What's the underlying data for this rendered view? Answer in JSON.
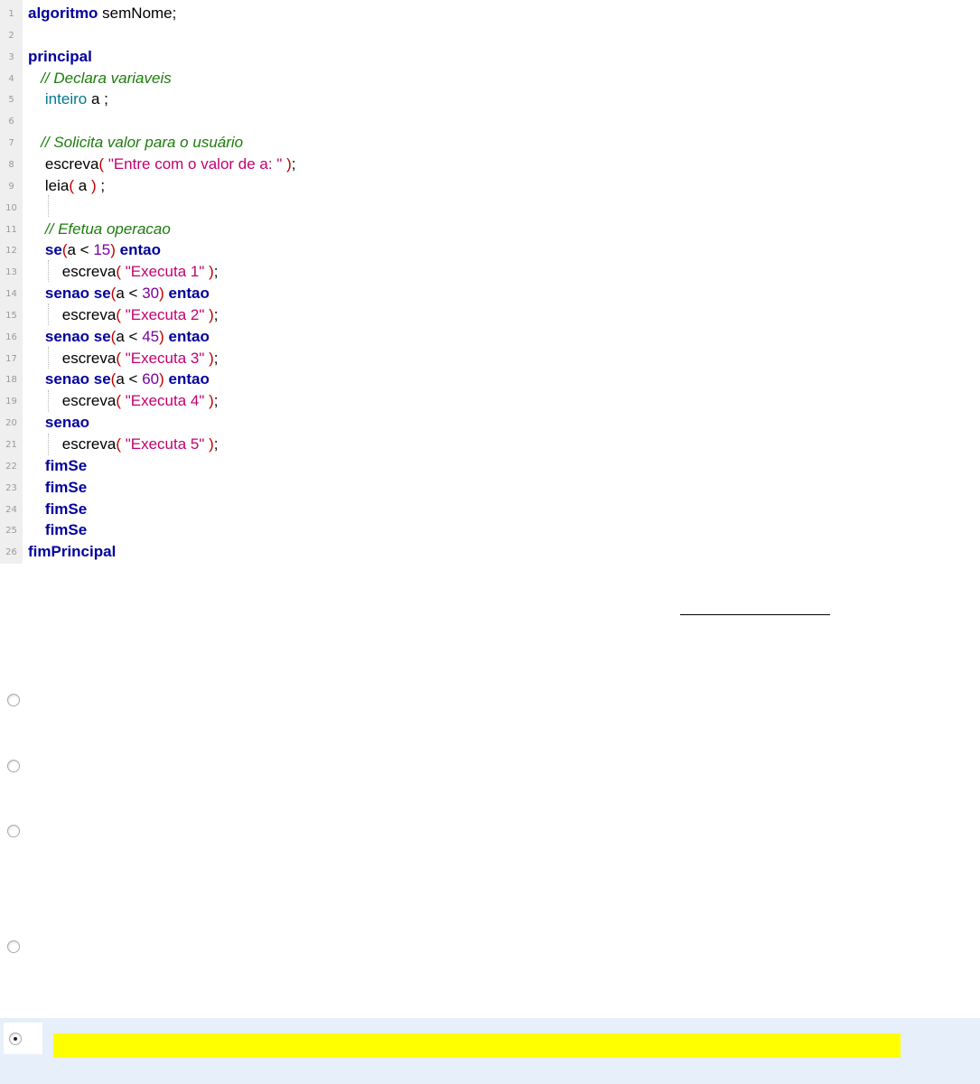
{
  "code": {
    "lines": [
      {
        "n": "1",
        "tokens": [
          [
            "kw",
            "algoritmo"
          ],
          [
            "plain",
            " semNome;"
          ]
        ]
      },
      {
        "n": "2",
        "tokens": []
      },
      {
        "n": "3",
        "tokens": [
          [
            "kw",
            "principal"
          ]
        ]
      },
      {
        "n": "4",
        "tokens": [
          [
            "plain",
            "   "
          ],
          [
            "cm",
            "// Declara variaveis"
          ]
        ]
      },
      {
        "n": "5",
        "tokens": [
          [
            "plain",
            "    "
          ],
          [
            "ty",
            "inteiro"
          ],
          [
            "plain",
            " a ;"
          ]
        ]
      },
      {
        "n": "6",
        "tokens": []
      },
      {
        "n": "7",
        "tokens": [
          [
            "plain",
            "   "
          ],
          [
            "cm",
            "// Solicita valor para o usuário"
          ]
        ]
      },
      {
        "n": "8",
        "tokens": [
          [
            "plain",
            "    escreva"
          ],
          [
            "pa",
            "( "
          ],
          [
            "st",
            "\"Entre com o valor de a: \""
          ],
          [
            "pa",
            " )"
          ],
          [
            "plain",
            ";"
          ]
        ]
      },
      {
        "n": "9",
        "tokens": [
          [
            "plain",
            "    leia"
          ],
          [
            "pa",
            "( "
          ],
          [
            "plain",
            "a "
          ],
          [
            "pa",
            ")"
          ],
          [
            "plain",
            " ;"
          ]
        ]
      },
      {
        "n": "10",
        "tokens": []
      },
      {
        "n": "11",
        "tokens": [
          [
            "plain",
            "    "
          ],
          [
            "cm",
            "// Efetua operacao"
          ]
        ]
      },
      {
        "n": "12",
        "tokens": [
          [
            "plain",
            "    "
          ],
          [
            "kw",
            "se"
          ],
          [
            "pa",
            "("
          ],
          [
            "plain",
            "a < "
          ],
          [
            "nu",
            "15"
          ],
          [
            "pa",
            ")"
          ],
          [
            "plain",
            " "
          ],
          [
            "kw",
            "entao"
          ]
        ]
      },
      {
        "n": "13",
        "tokens": [
          [
            "plain",
            "        escreva"
          ],
          [
            "pa",
            "( "
          ],
          [
            "st",
            "\"Executa 1\""
          ],
          [
            "pa",
            " )"
          ],
          [
            "plain",
            ";"
          ]
        ]
      },
      {
        "n": "14",
        "tokens": [
          [
            "plain",
            "    "
          ],
          [
            "kw",
            "senao se"
          ],
          [
            "pa",
            "("
          ],
          [
            "plain",
            "a < "
          ],
          [
            "nu",
            "30"
          ],
          [
            "pa",
            ")"
          ],
          [
            "plain",
            " "
          ],
          [
            "kw",
            "entao"
          ]
        ]
      },
      {
        "n": "15",
        "tokens": [
          [
            "plain",
            "        escreva"
          ],
          [
            "pa",
            "( "
          ],
          [
            "st",
            "\"Executa 2\""
          ],
          [
            "pa",
            " )"
          ],
          [
            "plain",
            ";"
          ]
        ]
      },
      {
        "n": "16",
        "tokens": [
          [
            "plain",
            "    "
          ],
          [
            "kw",
            "senao se"
          ],
          [
            "pa",
            "("
          ],
          [
            "plain",
            "a < "
          ],
          [
            "nu",
            "45"
          ],
          [
            "pa",
            ")"
          ],
          [
            "plain",
            " "
          ],
          [
            "kw",
            "entao"
          ]
        ]
      },
      {
        "n": "17",
        "tokens": [
          [
            "plain",
            "        escreva"
          ],
          [
            "pa",
            "( "
          ],
          [
            "st",
            "\"Executa 3\""
          ],
          [
            "pa",
            " )"
          ],
          [
            "plain",
            ";"
          ]
        ]
      },
      {
        "n": "18",
        "tokens": [
          [
            "plain",
            "    "
          ],
          [
            "kw",
            "senao se"
          ],
          [
            "pa",
            "("
          ],
          [
            "plain",
            "a < "
          ],
          [
            "nu",
            "60"
          ],
          [
            "pa",
            ")"
          ],
          [
            "plain",
            " "
          ],
          [
            "kw",
            "entao"
          ]
        ]
      },
      {
        "n": "19",
        "tokens": [
          [
            "plain",
            "        escreva"
          ],
          [
            "pa",
            "( "
          ],
          [
            "st",
            "\"Executa 4\""
          ],
          [
            "pa",
            " )"
          ],
          [
            "plain",
            ";"
          ]
        ]
      },
      {
        "n": "20",
        "tokens": [
          [
            "plain",
            "    "
          ],
          [
            "kw",
            "senao"
          ]
        ]
      },
      {
        "n": "21",
        "tokens": [
          [
            "plain",
            "        escreva"
          ],
          [
            "pa",
            "( "
          ],
          [
            "st",
            "\"Executa 5\""
          ],
          [
            "pa",
            " )"
          ],
          [
            "plain",
            ";"
          ]
        ]
      },
      {
        "n": "22",
        "tokens": [
          [
            "plain",
            "    "
          ],
          [
            "kw",
            "fimSe"
          ]
        ]
      },
      {
        "n": "23",
        "tokens": [
          [
            "plain",
            "    "
          ],
          [
            "kw",
            "fimSe"
          ]
        ]
      },
      {
        "n": "24",
        "tokens": [
          [
            "plain",
            "    "
          ],
          [
            "kw",
            "fimSe"
          ]
        ]
      },
      {
        "n": "25",
        "tokens": [
          [
            "plain",
            "    "
          ],
          [
            "kw",
            "fimSe"
          ]
        ]
      },
      {
        "n": "26",
        "tokens": [
          [
            "kw",
            "fimPrincipal"
          ]
        ]
      }
    ]
  },
  "options": [
    {
      "id": "option-1",
      "selected": false
    },
    {
      "id": "option-2",
      "selected": false
    },
    {
      "id": "option-3",
      "selected": false
    },
    {
      "id": "option-4",
      "selected": false
    },
    {
      "id": "option-5",
      "selected": true
    }
  ],
  "colors": {
    "keyword": "#00009d",
    "type": "#007a8c",
    "comment": "#1d7c0d",
    "string": "#c30070",
    "number": "#7a00a0",
    "paren": "#c00000",
    "highlight": "#ffff00",
    "selected_background": "#e7effa"
  }
}
